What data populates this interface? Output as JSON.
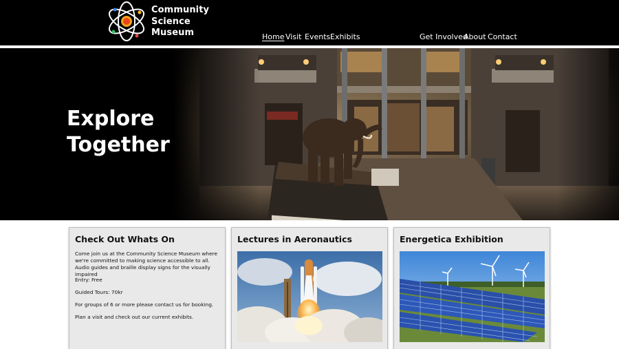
{
  "brand": {
    "line1": "Community",
    "line2": "Science",
    "line3": "Museum"
  },
  "nav": {
    "left": [
      "Home",
      "Visit",
      "Events",
      "Exhibits"
    ],
    "right": [
      "Get Involved",
      "About",
      "Contact"
    ]
  },
  "hero": {
    "line1": "Explore",
    "line2": "Together"
  },
  "cards": [
    {
      "title": "Check Out Whats On",
      "paragraphs": [
        "Come join us at the Community Science Museum where we're committed to making science accessible to all. Audio guides and braille display signs for the visually impaired",
        "Entry: Free",
        "Guided Tours: 70kr",
        "For groups of 6 or more please contact us for booking.",
        "Plan a visit and check out our current exhibits."
      ]
    },
    {
      "title": "Lectures in Aeronautics"
    },
    {
      "title": "Energetica Exhibition"
    }
  ],
  "colors": {
    "header_bg": "#000000",
    "card_bg": "#e9e9e9",
    "text_light": "#ffffff"
  },
  "icons": {
    "logo": "atom-sun-logo"
  }
}
